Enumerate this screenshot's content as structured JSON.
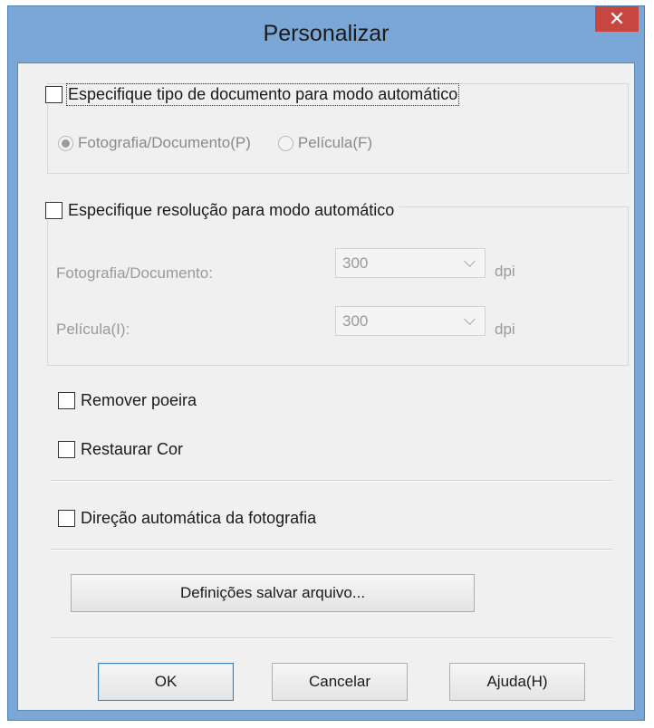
{
  "window": {
    "title": "Personalizar",
    "close_glyph": "✕"
  },
  "auto_doc_type": {
    "label": "Especifique tipo de documento para modo automático",
    "checked": false,
    "options": [
      {
        "label": "Fotografia/Documento(P)",
        "selected": true
      },
      {
        "label": "Película(F)",
        "selected": false
      }
    ]
  },
  "auto_resolution": {
    "label": "Especifique resolução para modo automático",
    "checked": false,
    "rows": [
      {
        "label": "Fotografia/Documento:",
        "value": "300",
        "unit": "dpi"
      },
      {
        "label": "Película(I):",
        "value": "300",
        "unit": "dpi"
      }
    ]
  },
  "options": [
    {
      "label": "Remover poeira",
      "checked": false
    },
    {
      "label": "Restaurar Cor",
      "checked": false
    },
    {
      "label": "Direção automática da fotografia",
      "checked": false
    }
  ],
  "buttons": {
    "save_settings": "Definições salvar arquivo...",
    "ok": "OK",
    "cancel": "Cancelar",
    "help": "Ajuda(H)"
  }
}
